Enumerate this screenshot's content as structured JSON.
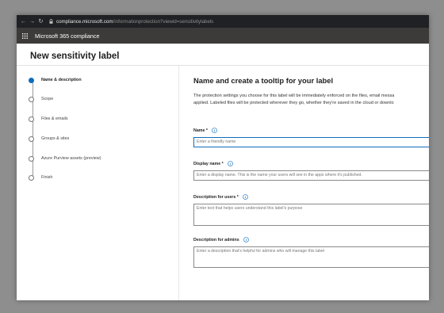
{
  "browser": {
    "url_host": "compliance.microsoft.com",
    "url_path": "/informationprotection?viewid=sensitivitylabels",
    "back_icon": "←",
    "forward_icon": "→",
    "reload_icon": "↻"
  },
  "app": {
    "title": "Microsoft 365 compliance"
  },
  "page": {
    "title": "New sensitivity label"
  },
  "steps": [
    {
      "label": "Name & description",
      "active": true
    },
    {
      "label": "Scope",
      "active": false
    },
    {
      "label": "Files & emails",
      "active": false
    },
    {
      "label": "Groups & sites",
      "active": false
    },
    {
      "label": "Azure Purview assets (preview)",
      "active": false
    },
    {
      "label": "Finish",
      "active": false
    }
  ],
  "main": {
    "heading": "Name and create a tooltip for your label",
    "description_line1": "The protection settings you choose for this label will be immediately enforced on the files, email messa",
    "description_line2": "applied. Labeled files will be protected wherever they go, whether they're saved in the cloud or downlo"
  },
  "form": {
    "name_label": "Name *",
    "name_placeholder": "Enter a friendly name",
    "display_label": "Display name *",
    "display_placeholder": "Enter a display name. This is the name your users will see in the apps where it's published.",
    "users_label": "Description for users *",
    "users_placeholder": "Enter text that helps users understand this label's purpose",
    "admins_label": "Description for admins",
    "admins_placeholder": "Enter a description that's helpful for admins who will manage this label"
  },
  "colors": {
    "accent": "#0f6cbd",
    "header": "#3c3b3a",
    "browser": "#202124"
  }
}
